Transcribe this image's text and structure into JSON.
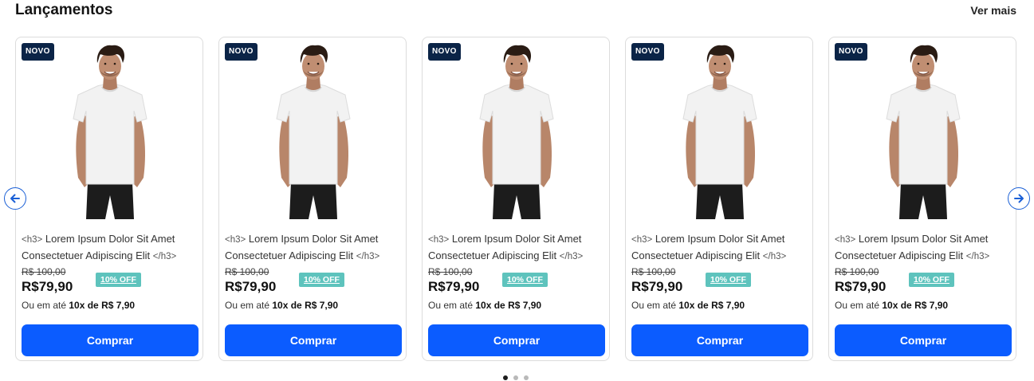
{
  "section": {
    "title": "Lançamentos",
    "see_more": "Ver mais"
  },
  "products": [
    {
      "badge": "NOVO",
      "tag_open": "<h3>",
      "name": "Lorem Ipsum Dolor Sit Amet Consectetuer Adipiscing Elit",
      "tag_close": "</h3>",
      "old_price": "R$ 100,00",
      "price": "R$79,90",
      "discount": "10% OFF",
      "installments_prefix": "Ou em até",
      "installments_value": "10x de R$ 7,90",
      "button": "Comprar"
    },
    {
      "badge": "NOVO",
      "tag_open": "<h3>",
      "name": "Lorem Ipsum Dolor Sit Amet Consectetuer Adipiscing Elit",
      "tag_close": "</h3>",
      "old_price": "R$ 100,00",
      "price": "R$79,90",
      "discount": "10% OFF",
      "installments_prefix": "Ou em até",
      "installments_value": "10x de R$ 7,90",
      "button": "Comprar"
    },
    {
      "badge": "NOVO",
      "tag_open": "<h3>",
      "name": "Lorem Ipsum Dolor Sit Amet Consectetuer Adipiscing Elit",
      "tag_close": "</h3>",
      "old_price": "R$ 100,00",
      "price": "R$79,90",
      "discount": "10% OFF",
      "installments_prefix": "Ou em até",
      "installments_value": "10x de R$ 7,90",
      "button": "Comprar"
    },
    {
      "badge": "NOVO",
      "tag_open": "<h3>",
      "name": "Lorem Ipsum Dolor Sit Amet Consectetuer Adipiscing Elit",
      "tag_close": "</h3>",
      "old_price": "R$ 100,00",
      "price": "R$79,90",
      "discount": "10% OFF",
      "installments_prefix": "Ou em até",
      "installments_value": "10x de R$ 7,90",
      "button": "Comprar"
    },
    {
      "badge": "NOVO",
      "tag_open": "<h3>",
      "name": "Lorem Ipsum Dolor Sit Amet Consectetuer Adipiscing Elit",
      "tag_close": "</h3>",
      "old_price": "R$ 100,00",
      "price": "R$79,90",
      "discount": "10% OFF",
      "installments_prefix": "Ou em até",
      "installments_value": "10x de R$ 7,90",
      "button": "Comprar"
    }
  ],
  "pagination": {
    "active_index": 0
  },
  "colors": {
    "badge": "#0b2447",
    "button": "#0b5cff",
    "discount": "#5ec3bd",
    "arrow": "#1a5fd6"
  },
  "icons": {
    "prev": "arrow-left-icon",
    "next": "arrow-right-icon"
  }
}
